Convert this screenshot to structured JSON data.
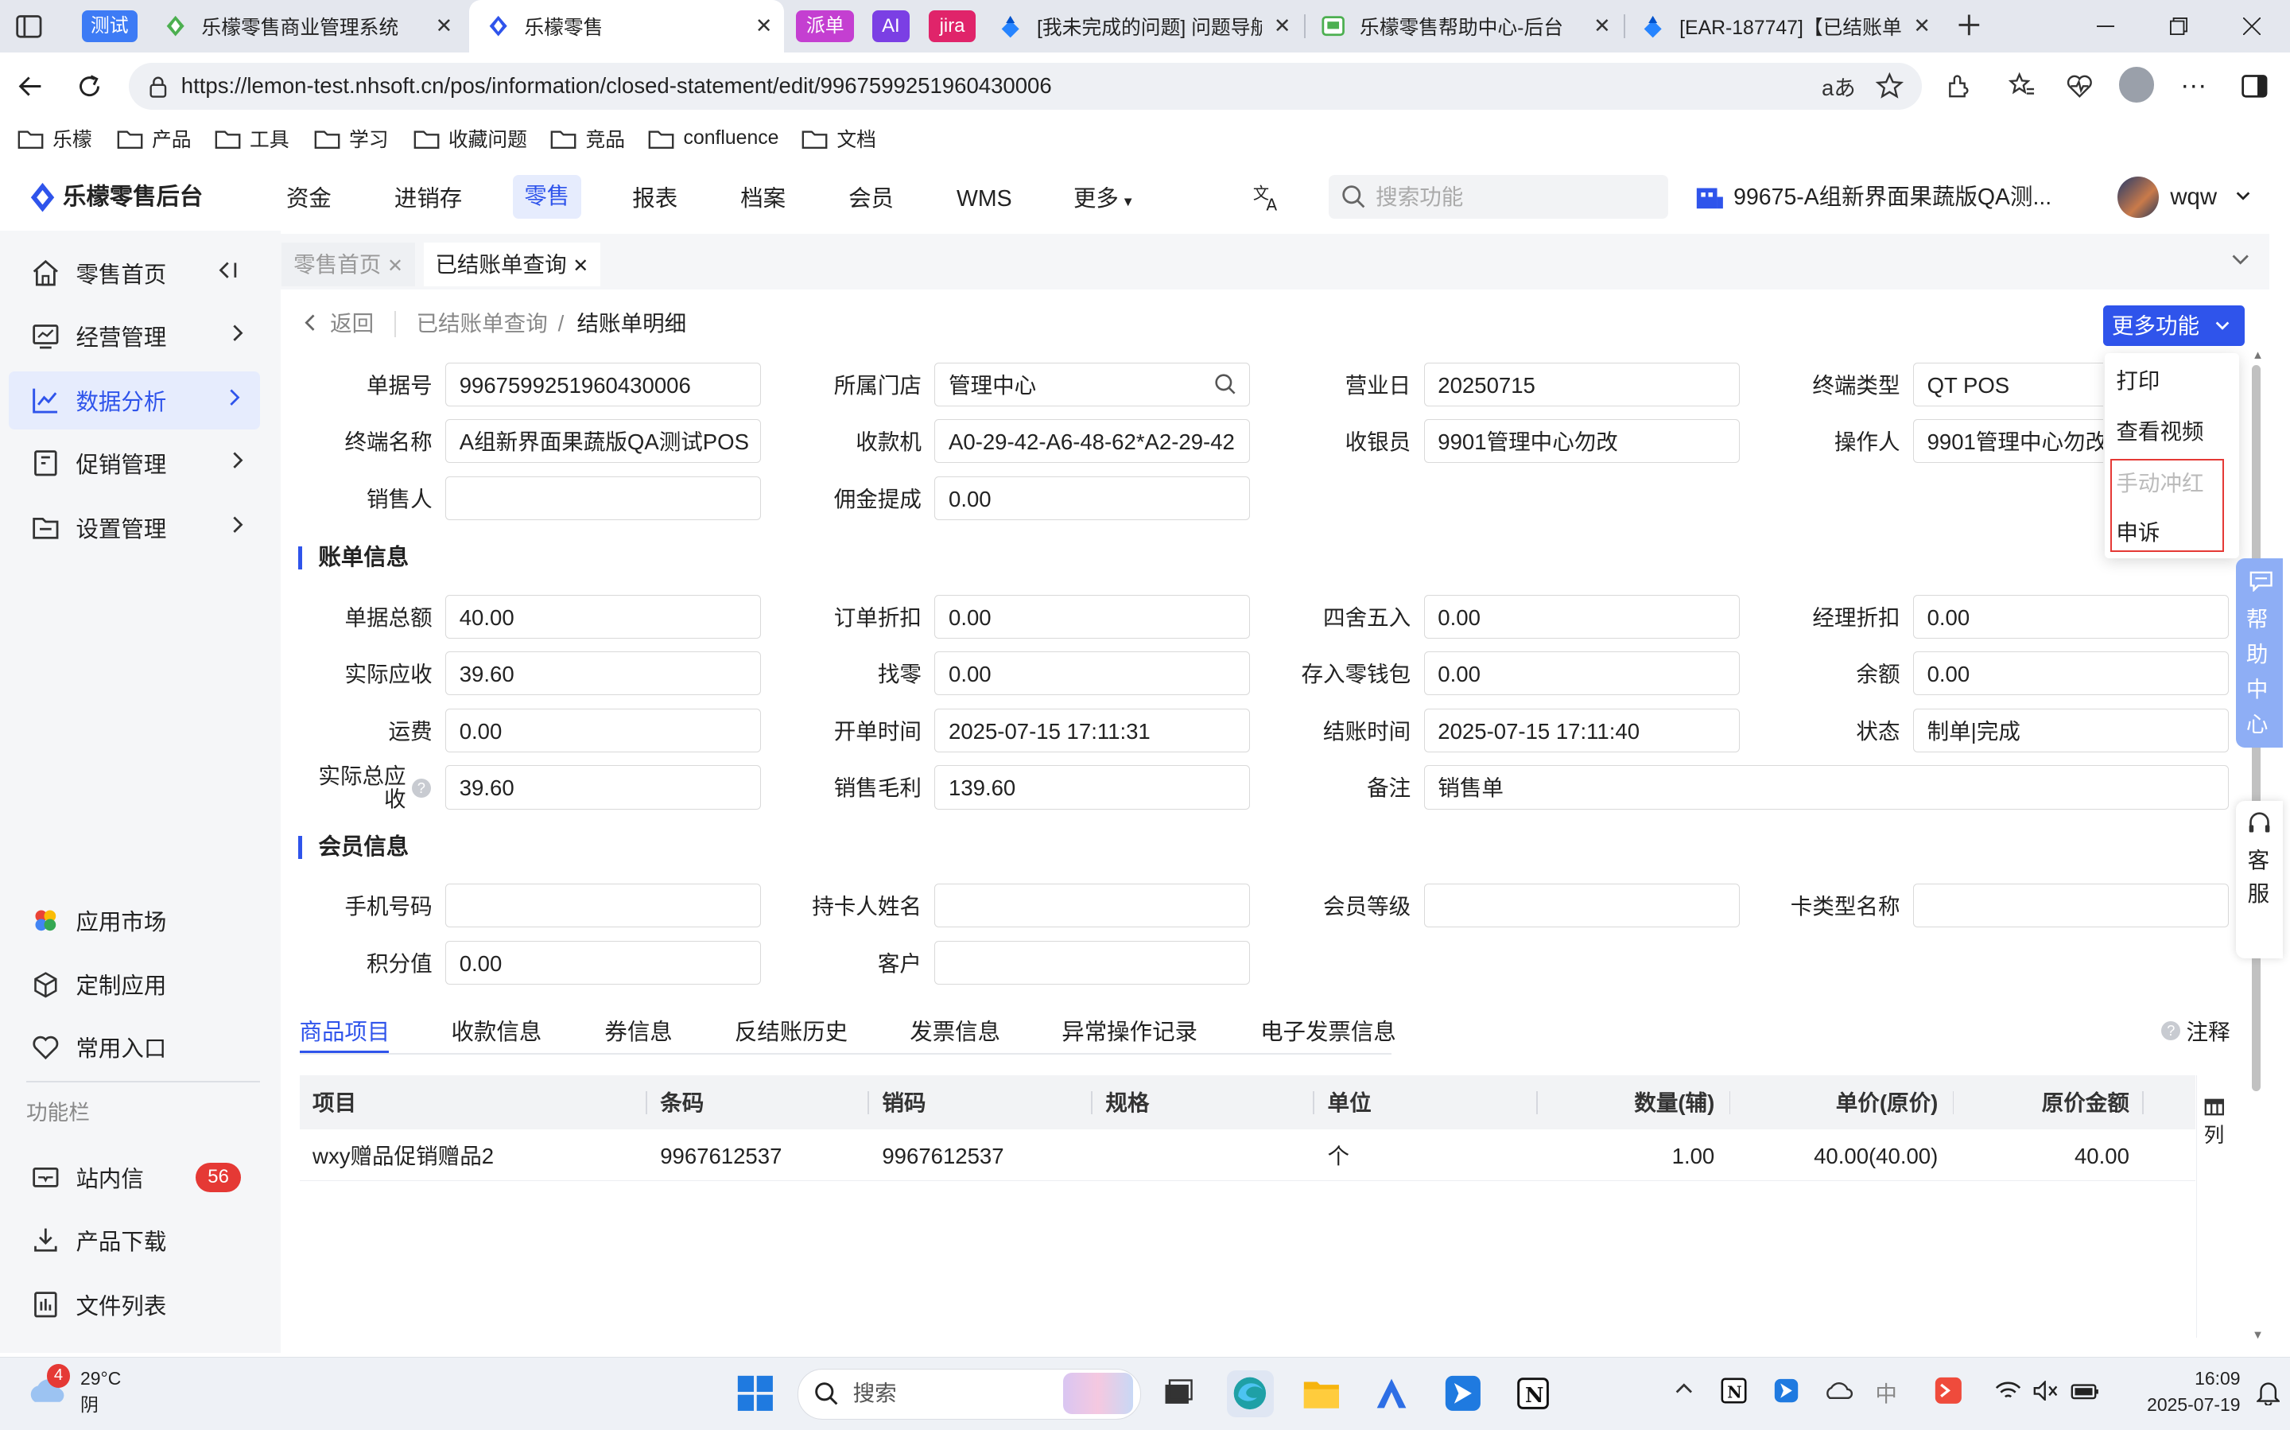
{
  "browser": {
    "chips": {
      "test": "测试",
      "paidan": "派单",
      "ai": "AI",
      "jira": "jira"
    },
    "tabs": [
      {
        "title": "乐檬零售商业管理系统"
      },
      {
        "title": "乐檬零售"
      },
      {
        "title": "[我未完成的问题] 问题导航"
      },
      {
        "title": "乐檬零售帮助中心-后台"
      },
      {
        "title": "[EAR-187747]【已结账单"
      }
    ],
    "url": "https://lemon-test.nhsoft.cn/pos/information/closed-statement/edit/9967599251960430006",
    "bookmarks": [
      "乐檬",
      "产品",
      "工具",
      "学习",
      "收藏问题",
      "竞品",
      "confluence",
      "文档"
    ]
  },
  "app": {
    "logo": "乐檬零售后台",
    "nav": [
      "资金",
      "进销存",
      "零售",
      "报表",
      "档案",
      "会员",
      "WMS",
      "更多"
    ],
    "search_placeholder": "搜索功能",
    "store": "99675-A组新界面果蔬版QA测...",
    "user": "wqw"
  },
  "sidebar": {
    "items": [
      "零售首页",
      "经营管理",
      "数据分析",
      "促销管理",
      "设置管理"
    ],
    "bottom": [
      "应用市场",
      "定制应用",
      "常用入口"
    ],
    "section": "功能栏",
    "tools": [
      "站内信",
      "产品下载",
      "文件列表"
    ],
    "badge": "56"
  },
  "page_tabs": [
    "零售首页",
    "已结账单查询"
  ],
  "breadcrumb": {
    "back": "返回",
    "parent": "已结账单查询",
    "sep": "/",
    "current": "结账单明细"
  },
  "more_button": "更多功能",
  "dropdown": [
    "打印",
    "查看视频",
    "手动冲红",
    "申诉"
  ],
  "form": {
    "bill_no": {
      "label": "单据号",
      "value": "9967599251960430006"
    },
    "store": {
      "label": "所属门店",
      "value": "管理中心"
    },
    "biz_day": {
      "label": "营业日",
      "value": "20250715"
    },
    "terminal_type": {
      "label": "终端类型",
      "value": "QT POS"
    },
    "terminal_name": {
      "label": "终端名称",
      "value": "A组新界面果蔬版QA测试POS"
    },
    "cashier_machine": {
      "label": "收款机",
      "value": "A0-29-42-A6-48-62*A2-29-42"
    },
    "cashier": {
      "label": "收银员",
      "value": "9901管理中心勿改"
    },
    "operator": {
      "label": "操作人",
      "value": "9901管理中心勿改"
    },
    "salesperson": {
      "label": "销售人",
      "value": ""
    },
    "commission": {
      "label": "佣金提成",
      "value": "0.00"
    }
  },
  "bill_section": "账单信息",
  "bill": {
    "total": {
      "label": "单据总额",
      "value": "40.00"
    },
    "order_discount": {
      "label": "订单折扣",
      "value": "0.00"
    },
    "rounding": {
      "label": "四舍五入",
      "value": "0.00"
    },
    "manager_discount": {
      "label": "经理折扣",
      "value": "0.00"
    },
    "receivable": {
      "label": "实际应收",
      "value": "39.60"
    },
    "change": {
      "label": "找零",
      "value": "0.00"
    },
    "wallet": {
      "label": "存入零钱包",
      "value": "0.00"
    },
    "balance": {
      "label": "余额",
      "value": "0.00"
    },
    "freight": {
      "label": "运费",
      "value": "0.00"
    },
    "open_time": {
      "label": "开单时间",
      "value": "2025-07-15 17:11:31"
    },
    "close_time": {
      "label": "结账时间",
      "value": "2025-07-15 17:11:40"
    },
    "status": {
      "label": "状态",
      "value": "制单|完成"
    },
    "total_receivable_l1": "实际总应",
    "total_receivable_l2": "收",
    "total_receivable": "39.60",
    "gross_profit": {
      "label": "销售毛利",
      "value": "139.60"
    },
    "remark": {
      "label": "备注",
      "value": "销售单"
    }
  },
  "member_section": "会员信息",
  "member": {
    "phone": {
      "label": "手机号码",
      "value": ""
    },
    "holder": {
      "label": "持卡人姓名",
      "value": ""
    },
    "level": {
      "label": "会员等级",
      "value": ""
    },
    "card_type": {
      "label": "卡类型名称",
      "value": ""
    },
    "points": {
      "label": "积分值",
      "value": "0.00"
    },
    "customer": {
      "label": "客户",
      "value": ""
    }
  },
  "detail_tabs": [
    "商品项目",
    "收款信息",
    "券信息",
    "反结账历史",
    "发票信息",
    "异常操作记录",
    "电子发票信息"
  ],
  "note": "注释",
  "table": {
    "headers": [
      "项目",
      "条码",
      "销码",
      "规格",
      "单位",
      "数量(辅)",
      "单价(原价)",
      "原价金额"
    ],
    "rows": [
      {
        "item": "wxy赠品促销赠品2",
        "barcode": "9967612537",
        "salecode": "9967612537",
        "spec": "",
        "unit": "个",
        "qty": "1.00",
        "price": "40.00(40.00)",
        "amount": "40.00"
      }
    ],
    "col_setting": "列"
  },
  "help": {
    "float": [
      "帮",
      "助",
      "中",
      "心"
    ],
    "kefu": [
      "客",
      "服"
    ]
  },
  "taskbar": {
    "weather_temp": "29°C",
    "weather_desc": "阴",
    "weather_badge": "4",
    "search": "搜索",
    "time": "16:09",
    "date": "2025-07-19"
  },
  "colors": {
    "accent": "#2f54eb",
    "danger": "#e53935"
  }
}
